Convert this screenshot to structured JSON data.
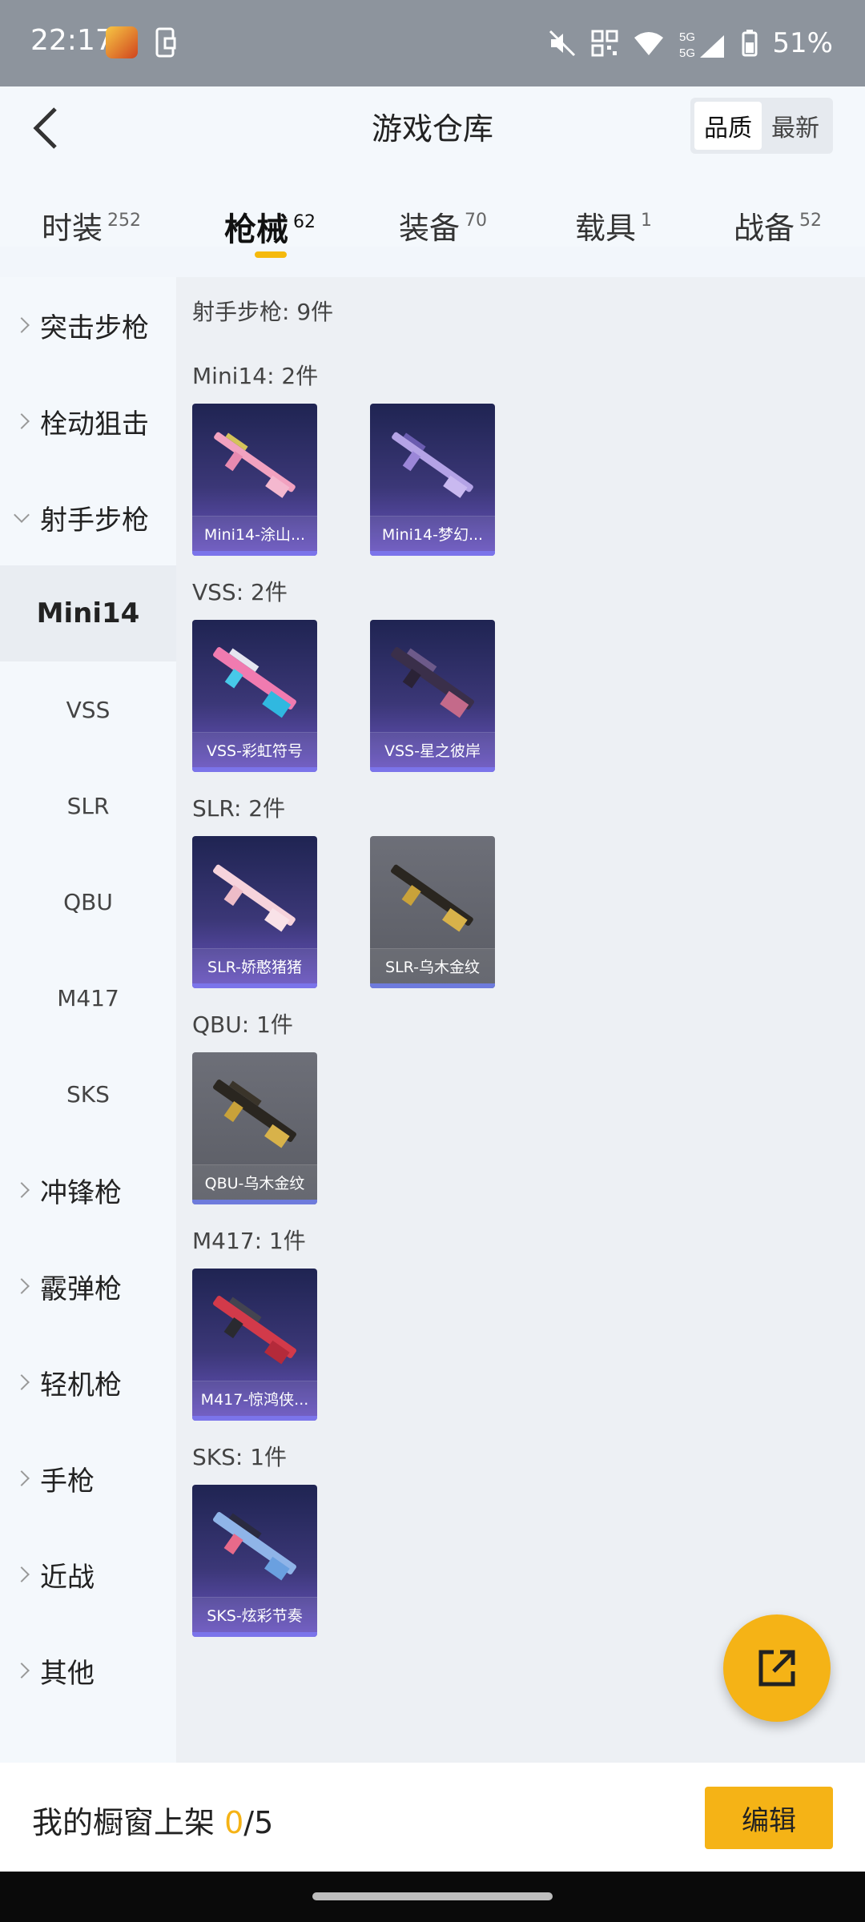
{
  "status_bar": {
    "time": "22:17",
    "network_label": "5G",
    "battery": "51%"
  },
  "header": {
    "title": "游戏仓库",
    "sort_options": [
      "品质",
      "最新"
    ],
    "sort_selected": "品质"
  },
  "tabs": [
    {
      "label": "时装",
      "count": "252"
    },
    {
      "label": "枪械",
      "count": "62"
    },
    {
      "label": "装备",
      "count": "70"
    },
    {
      "label": "载具",
      "count": "1"
    },
    {
      "label": "战备",
      "count": "52"
    }
  ],
  "sidebar": {
    "categories": [
      {
        "label": "突击步枪",
        "expanded": false
      },
      {
        "label": "栓动狙击",
        "expanded": false
      },
      {
        "label": "射手步枪",
        "expanded": true
      },
      {
        "label": "冲锋枪",
        "expanded": false
      },
      {
        "label": "霰弹枪",
        "expanded": false
      },
      {
        "label": "轻机枪",
        "expanded": false
      },
      {
        "label": "手枪",
        "expanded": false
      },
      {
        "label": "近战",
        "expanded": false
      },
      {
        "label": "其他",
        "expanded": false
      }
    ],
    "subcategories": [
      "Mini14",
      "VSS",
      "SLR",
      "QBU",
      "M417",
      "SKS"
    ],
    "sub_selected": "Mini14"
  },
  "content": {
    "category_summary": "射手步枪: 9件",
    "groups": [
      {
        "label": "Mini14: 2件",
        "items": [
          {
            "name": "Mini14-涂山...",
            "rarity": "purple"
          },
          {
            "name": "Mini14-梦幻...",
            "rarity": "purple"
          }
        ]
      },
      {
        "label": "VSS: 2件",
        "items": [
          {
            "name": "VSS-彩虹符号",
            "rarity": "purple"
          },
          {
            "name": "VSS-星之彼岸",
            "rarity": "purple"
          }
        ]
      },
      {
        "label": "SLR: 2件",
        "items": [
          {
            "name": "SLR-娇憨猪猪",
            "rarity": "purple"
          },
          {
            "name": "SLR-乌木金纹",
            "rarity": "gray"
          }
        ]
      },
      {
        "label": "QBU: 1件",
        "items": [
          {
            "name": "QBU-乌木金纹",
            "rarity": "gray"
          }
        ]
      },
      {
        "label": "M417: 1件",
        "items": [
          {
            "name": "M417-惊鸿侠...",
            "rarity": "purple"
          }
        ]
      },
      {
        "label": "SKS: 1件",
        "items": [
          {
            "name": "SKS-炫彩节奏",
            "rarity": "purple"
          }
        ]
      }
    ]
  },
  "bottom_bar": {
    "showcase_prefix": "我的橱窗上架 ",
    "showcase_current": "0",
    "showcase_total": "/5",
    "edit_label": "编辑"
  },
  "colors": {
    "accent": "#f5b316",
    "purple_card": "#3b3777",
    "gray_card": "#5a5c64"
  }
}
